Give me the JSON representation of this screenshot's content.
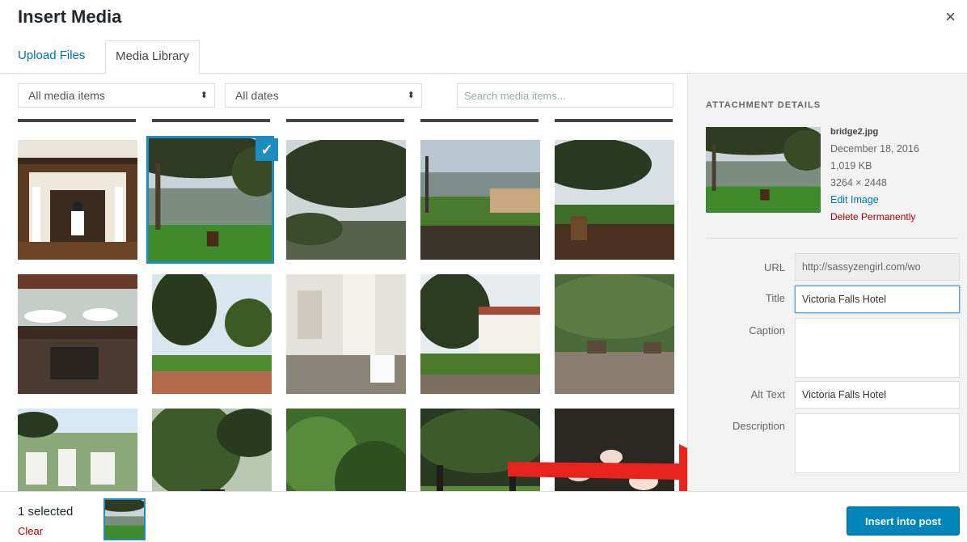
{
  "modal": {
    "title": "Insert Media",
    "close_glyph": "×"
  },
  "tabs": [
    {
      "label": "Upload Files",
      "active": false
    },
    {
      "label": "Media Library",
      "active": true
    }
  ],
  "filters": {
    "media_type": "All media items",
    "dates": "All dates",
    "arrows_glyph": "⬍",
    "search_placeholder": "Search media items..."
  },
  "selected_check_glyph": "✓",
  "attachment": {
    "heading": "ATTACHMENT DETAILS",
    "filename": "bridge2.jpg",
    "date": "December 18, 2016",
    "size": "1,019 KB",
    "dimensions": "3264 × 2448",
    "edit_label": "Edit Image",
    "delete_label": "Delete Permanently",
    "fields": {
      "url_label": "URL",
      "url_value": "http://sassyzengirl.com/wo",
      "title_label": "Title",
      "title_value": "Victoria Falls Hotel",
      "caption_label": "Caption",
      "alt_label": "Alt Text",
      "alt_value": "Victoria Falls Hotel",
      "description_label": "Description"
    }
  },
  "footer": {
    "selected_count": "1 selected",
    "clear_label": "Clear",
    "insert_label": "Insert into post"
  },
  "colors": {
    "accent": "#1e8cbe",
    "button": "#0085ba",
    "link": "#0073aa",
    "danger": "#a00000",
    "arrow": "#e8231e"
  }
}
